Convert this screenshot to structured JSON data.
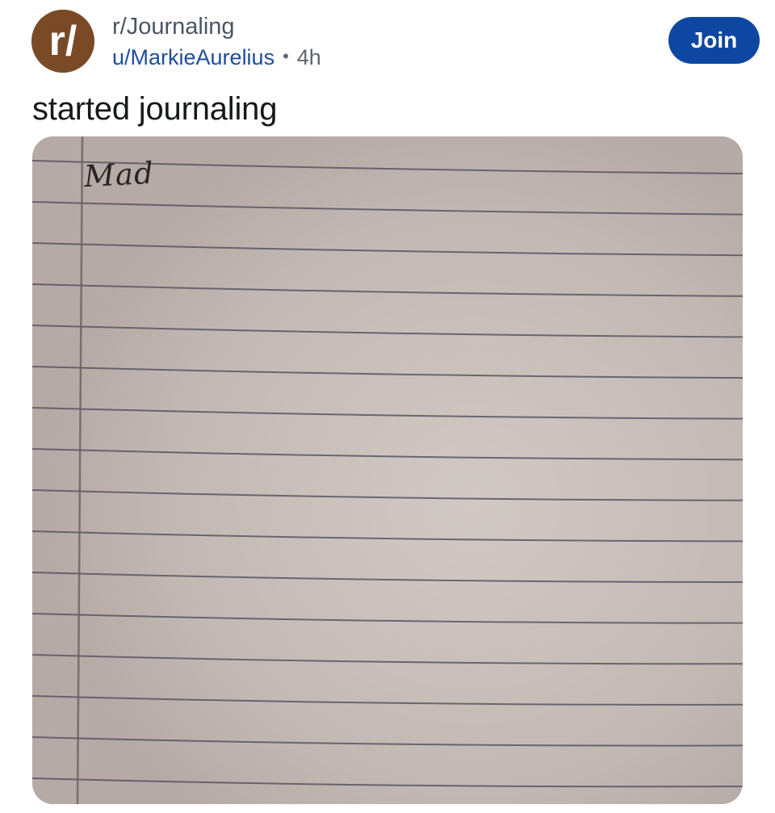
{
  "post": {
    "subreddit": "r/Journaling",
    "avatar_text": "r/",
    "author": "u/MarkieAurelius",
    "separator": "•",
    "time": "4h",
    "join_label": "Join",
    "title": "started journaling"
  },
  "image": {
    "handwritten_text": "Mad"
  },
  "colors": {
    "avatar_bg": "#7a4a27",
    "join_bg": "#0d47a1",
    "author_link": "#1e4d9b",
    "paper": "#c4bab4",
    "ruled_line": "#5b5560"
  },
  "icons": {
    "avatar": "subreddit-avatar-icon"
  }
}
